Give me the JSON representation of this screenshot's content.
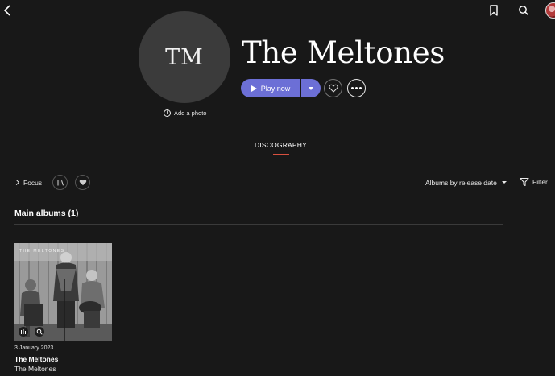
{
  "artist": {
    "initials": "TM",
    "name": "The Meltones",
    "add_photo_label": "Add a photo"
  },
  "actions": {
    "play_label": "Play now"
  },
  "tabs": [
    {
      "label": "DISCOGRAPHY",
      "active": true
    }
  ],
  "filters": {
    "focus_label": "Focus",
    "sort_label": "Albums by release date",
    "filter_label": "Filter"
  },
  "sections": [
    {
      "title": "Main albums (1)",
      "albums": [
        {
          "release_date": "3 January 2023",
          "title": "The Meltones",
          "artist": "The Meltones",
          "cover_text": "THE MELTONES"
        }
      ]
    }
  ],
  "colors": {
    "background": "#181818",
    "accent": "#6c6fd6",
    "tab_indicator": "#d8503f",
    "avatar_bg": "#3b3b3b"
  },
  "icons": {
    "back": "chevron-left-icon",
    "bookmark": "bookmark-icon",
    "search": "search-icon",
    "info": "info-icon",
    "play": "play-icon",
    "heart": "heart-icon",
    "more": "more-horizontal-icon",
    "library": "library-icon",
    "filter": "funnel-icon"
  }
}
